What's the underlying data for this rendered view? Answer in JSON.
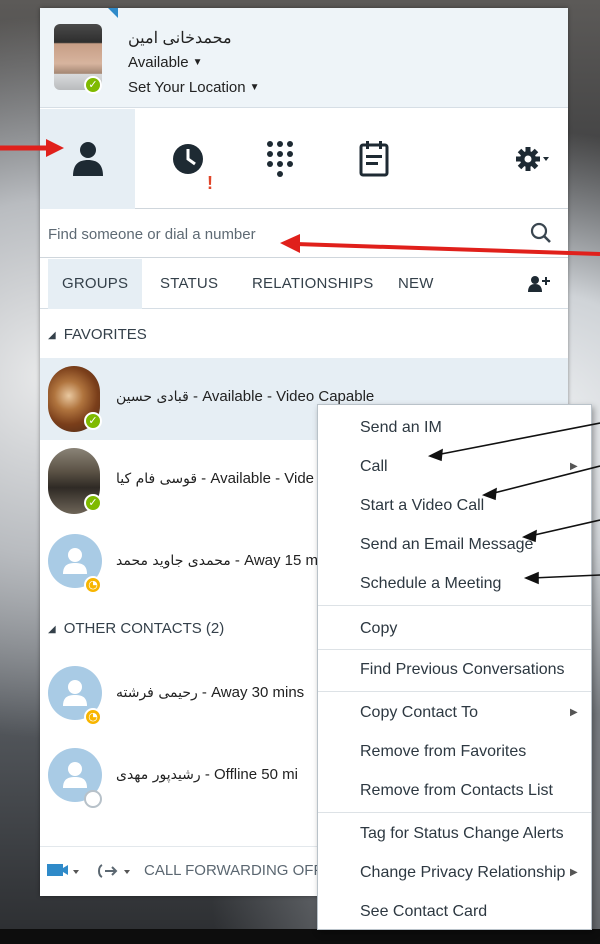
{
  "profile": {
    "name": "محمدخانی امین",
    "status": "Available",
    "location": "Set Your Location"
  },
  "toolbar": {
    "icons": [
      "contacts-icon",
      "recent-icon",
      "dialpad-icon",
      "meetings-icon",
      "gear-icon"
    ],
    "alert_mark": "!"
  },
  "search": {
    "placeholder": "Find someone or dial a number"
  },
  "tabs": [
    {
      "label": "GROUPS",
      "active": true
    },
    {
      "label": "STATUS",
      "active": false
    },
    {
      "label": "RELATIONSHIPS",
      "active": false
    },
    {
      "label": "NEW",
      "active": false
    }
  ],
  "groups": {
    "favorites": "FAVORITES",
    "other": "OTHER CONTACTS (2)"
  },
  "contacts": [
    {
      "name": "قبادی حسین",
      "detail": " - Available - Video Capable",
      "presence": "available"
    },
    {
      "name": "قوسی فام کیا",
      "detail": " - Available - Vide",
      "presence": "available"
    },
    {
      "name": "محمدی جاوید محمد",
      "detail": " - Away 15 m",
      "presence": "away"
    },
    {
      "name": "رحیمی فرشته",
      "detail": " - Away 30 mins",
      "presence": "away"
    },
    {
      "name": "رشیدپور مهدی",
      "detail": " - Offline 50 mi",
      "presence": "offline"
    }
  ],
  "footer": {
    "call_forwarding": "CALL FORWARDING OFF"
  },
  "context_menu": [
    {
      "label": "Send an IM",
      "submenu": false
    },
    {
      "label": "Call",
      "submenu": true
    },
    {
      "label": "Start a Video Call",
      "submenu": false
    },
    {
      "label": "Send an Email Message",
      "submenu": false
    },
    {
      "label": "Schedule a Meeting",
      "submenu": false
    },
    {
      "label": "Copy",
      "submenu": false
    },
    {
      "label": "Find Previous Conversations",
      "submenu": false
    },
    {
      "label": "Copy Contact To",
      "submenu": true
    },
    {
      "label": "Remove from Favorites",
      "submenu": false
    },
    {
      "label": "Remove from Contacts List",
      "submenu": false
    },
    {
      "label": "Tag for Status Change Alerts",
      "submenu": false
    },
    {
      "label": "Change Privacy Relationship",
      "submenu": true
    },
    {
      "label": "See Contact Card",
      "submenu": false
    }
  ],
  "colors": {
    "accent": "#2f8ac9",
    "available": "#7fba00",
    "away": "#f8b500",
    "annotation_arrow_red": "#e0201b",
    "selected_row": "#e6eef4"
  }
}
